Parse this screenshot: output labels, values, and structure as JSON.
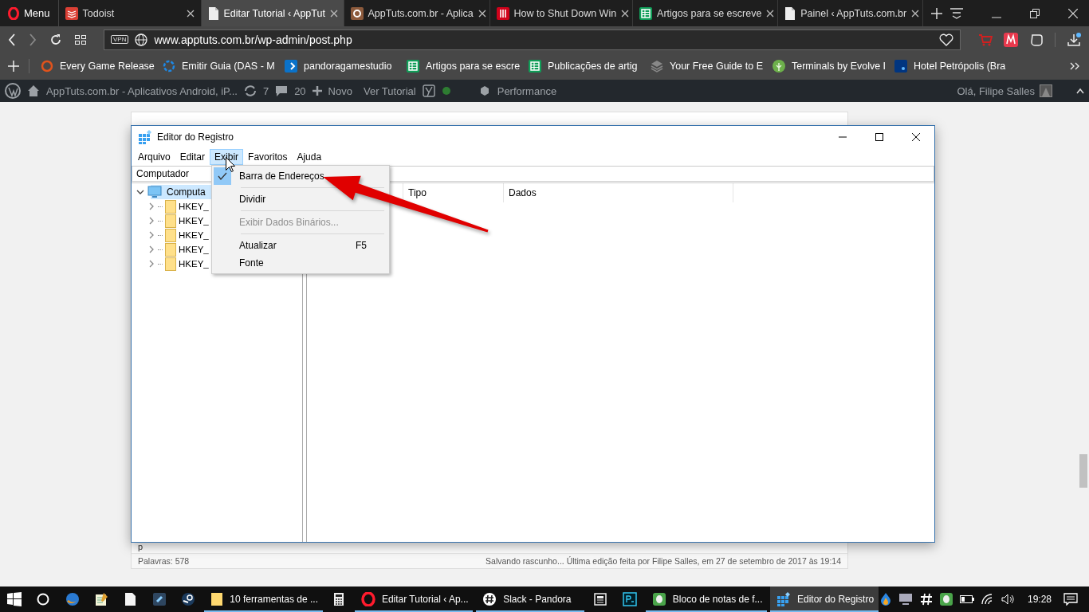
{
  "browser": {
    "menu_label": "Menu",
    "tabs": [
      {
        "label": "Todoist",
        "selected": false
      },
      {
        "label": "Editar Tutorial ‹ AppTut",
        "selected": true
      },
      {
        "label": "AppTuts.com.br - Aplica",
        "selected": false
      },
      {
        "label": "How to Shut Down Win",
        "selected": false
      },
      {
        "label": "Artigos para se escreve",
        "selected": false
      },
      {
        "label": "Painel ‹ AppTuts.com.br",
        "selected": false
      }
    ],
    "vpn_badge": "VPN",
    "url": "www.apptuts.com.br/wp-admin/post.php",
    "bookmarks": [
      "Every Game Release",
      "Emitir Guia (DAS - M",
      "pandoragamestudio",
      "Artigos para se escre",
      "Publicações de artig",
      "Your Free Guide to E",
      "Terminals by Evolve I",
      "Hotel Petrópolis (Bra"
    ]
  },
  "admin_bar": {
    "site": "AppTuts.com.br - Aplicativos Android, iP...",
    "updates": "7",
    "comments": "20",
    "new": "Novo",
    "view": "Ver Tutorial",
    "performance": "Performance",
    "greeting": "Olá, Filipe Salles"
  },
  "regedit": {
    "title": "Editor do Registro",
    "menu": [
      {
        "label": "Arquivo",
        "selected": false
      },
      {
        "label": "Editar",
        "selected": false
      },
      {
        "label": "Exibir",
        "selected": true
      },
      {
        "label": "Favoritos",
        "selected": false
      },
      {
        "label": "Ajuda",
        "selected": false
      }
    ],
    "address": "Computador",
    "tree": [
      {
        "label": "Computa",
        "selected": true,
        "expanded": true,
        "children": [
          {
            "label": "HKEY_",
            "selected": false,
            "expanded": false
          },
          {
            "label": "HKEY_",
            "selected": false,
            "expanded": false
          },
          {
            "label": "HKEY_",
            "selected": false,
            "expanded": false
          },
          {
            "label": "HKEY_",
            "selected": false,
            "expanded": false
          },
          {
            "label": "HKEY_",
            "selected": false,
            "expanded": false
          }
        ]
      }
    ],
    "columns": [
      "Tipo",
      "Dados"
    ],
    "dropdown": {
      "groups": [
        [
          {
            "label": "Barra de Endereços",
            "checked": true,
            "disabled": false
          }
        ],
        [
          {
            "label": "Dividir",
            "checked": false,
            "disabled": false
          }
        ],
        [
          {
            "label": "Exibir Dados Binários...",
            "checked": false,
            "disabled": true
          }
        ],
        [
          {
            "label": "Atualizar",
            "shortcut": "F5",
            "checked": false,
            "disabled": false
          },
          {
            "label": "Fonte",
            "checked": false,
            "disabled": false
          }
        ]
      ]
    }
  },
  "editor": {
    "paragraph": "p",
    "word_count": "Palavras: 578",
    "save_status": "Salvando rascunho... Última edição feita por Filipe Salles, em 27 de setembro de 2017 às 19:14"
  },
  "taskbar": {
    "items": [
      {
        "running": false,
        "selected": false
      },
      {
        "running": false,
        "selected": false
      },
      {
        "running": false,
        "selected": false
      },
      {
        "running": false,
        "selected": false
      },
      {
        "running": false,
        "selected": false
      },
      {
        "label": "10 ferramentas de ...",
        "running": true,
        "selected": false
      },
      {
        "running": false,
        "selected": false
      },
      {
        "label": "Editar Tutorial ‹ Ap...",
        "running": true,
        "selected": false
      },
      {
        "label": "Slack - Pandora",
        "running": true,
        "selected": false
      },
      {
        "running": false,
        "selected": false
      },
      {
        "running": false,
        "selected": false
      },
      {
        "label": "Bloco de notas de f...",
        "running": true,
        "selected": false
      },
      {
        "label": "Editor do Registro",
        "running": true,
        "selected": true
      }
    ],
    "clock": "19:28"
  }
}
